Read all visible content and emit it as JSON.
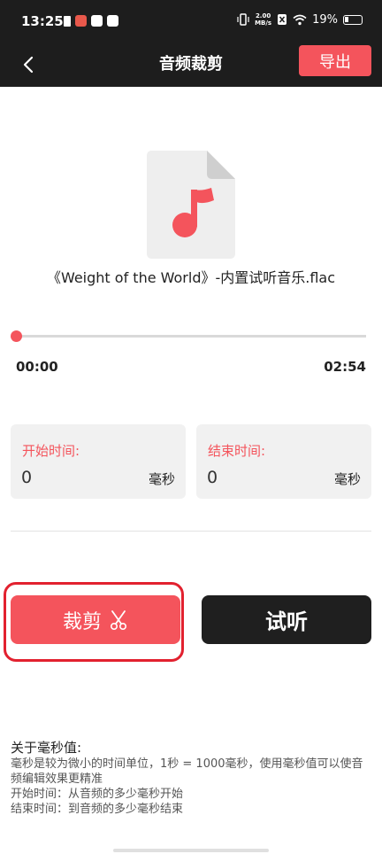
{
  "status_bar": {
    "time": "13:25",
    "speed_value": "2.00",
    "speed_unit": "MB/s",
    "battery": "19%"
  },
  "header": {
    "title": "音频裁剪",
    "export_label": "导出"
  },
  "file": {
    "name": "《Weight of the World》-内置试听音乐.flac"
  },
  "player": {
    "current_time": "00:00",
    "total_time": "02:54",
    "progress": 0
  },
  "start_input": {
    "label": "开始时间:",
    "value": "0",
    "unit": "毫秒"
  },
  "end_input": {
    "label": "结束时间:",
    "value": "0",
    "unit": "毫秒"
  },
  "actions": {
    "cut_label": "裁剪",
    "listen_label": "试听"
  },
  "note": {
    "title": "关于毫秒值:",
    "lines": [
      "毫秒是较为微小的时间单位，1秒 = 1000毫秒，使用毫秒值可以使音频编辑效果更精准",
      "开始时间：从音频的多少毫秒开始",
      "结束时间：到音频的多少毫秒结束"
    ]
  },
  "colors": {
    "accent": "#f4545c",
    "header_bg": "#1d1d1d",
    "highlight": "#e2212f"
  }
}
